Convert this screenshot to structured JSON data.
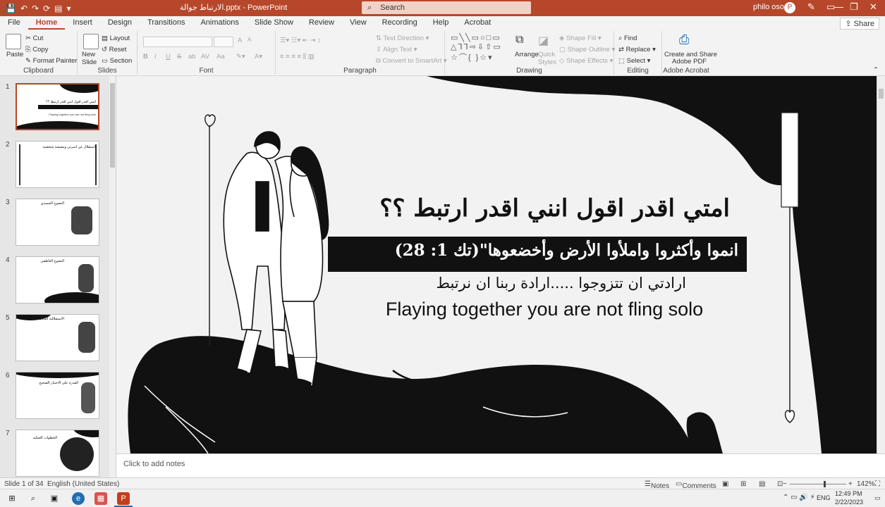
{
  "titlebar": {
    "qat": [
      "💾",
      "↶",
      "↷",
      "⟳",
      "▤",
      "▾"
    ],
    "doc_title": "الارتباط جوالة.pptx  -  PowerPoint",
    "search_placeholder": "Search",
    "user_name": "philo osos",
    "avatar_initial": "P",
    "controls": {
      "pen": "✎",
      "ribbon": "▭",
      "minimize": "—",
      "maximize": "❐",
      "close": "✕"
    }
  },
  "tabs": [
    "File",
    "Home",
    "Insert",
    "Design",
    "Transitions",
    "Animations",
    "Slide Show",
    "Review",
    "View",
    "Recording",
    "Help",
    "Acrobat"
  ],
  "active_tab": "Home",
  "share_label": "Share",
  "ribbon": {
    "clipboard": {
      "paste": "Paste",
      "cut": "Cut",
      "copy": "Copy",
      "format_painter": "Format Painter",
      "label": "Clipboard"
    },
    "slides": {
      "new_slide": "New Slide",
      "layout": "Layout",
      "reset": "Reset",
      "section": "Section",
      "label": "Slides"
    },
    "font": {
      "label": "Font",
      "bold": "B",
      "italic": "I",
      "underline": "U",
      "strike": "S",
      "shadow": "ab",
      "spacing": "AV",
      "case": "Aa",
      "grow": "A",
      "shrink": "A"
    },
    "paragraph": {
      "label": "Paragraph",
      "text_direction": "Text Direction",
      "align_text": "Align Text",
      "convert_smartart": "Convert to SmartArt"
    },
    "drawing": {
      "label": "Drawing",
      "arrange": "Arrange",
      "quick_styles": "Quick Styles",
      "shape_fill": "Shape Fill",
      "shape_outline": "Shape Outline",
      "shape_effects": "Shape Effects"
    },
    "editing": {
      "label": "Editing",
      "find": "Find",
      "replace": "Replace",
      "select": "Select"
    },
    "acrobat": {
      "label": "Adobe Acrobat",
      "create_share": "Create and Share",
      "adobe_pdf": "Adobe PDF"
    }
  },
  "thumbnails": [
    {
      "num": "1",
      "title": "امتي اقدر اقول انني اقدر ارتبط ؟؟",
      "sub": "Flaying together you are not fling solo"
    },
    {
      "num": "2",
      "title": "استقلال عن اسرتي ومعيشة شخصية",
      "sub": ""
    },
    {
      "num": "3",
      "title": "النضوج الجسدي",
      "sub": ""
    },
    {
      "num": "4",
      "title": "النضوج العاطفي",
      "sub": ""
    },
    {
      "num": "5",
      "title": "الاستقلالية المادية",
      "sub": ""
    },
    {
      "num": "6",
      "title": "القدرة على الاختيار الصحيح",
      "sub": ""
    },
    {
      "num": "7",
      "title": "الخطوات العملية",
      "sub": ""
    }
  ],
  "slide": {
    "title": "امتي اقدر اقول انني اقدر ارتبط ؟؟",
    "banner": "انموا وأكثروا واملأوا الأرض وأخضعوها\"(تك 1: 28)",
    "line_ar": "ارادتي ان تتزوجوا .....ارادة ربنا ان نرتبط",
    "line_en": "Flaying together you are not fling solo"
  },
  "notes_placeholder": "Click to add notes",
  "status": {
    "slide_of": "Slide 1 of 34",
    "language": "English (United States)",
    "notes": "Notes",
    "comments": "Comments",
    "zoom": "142%"
  },
  "taskbar": {
    "lang": "ENG",
    "time": "12:49 PM",
    "date": "2/22/2023"
  },
  "colors": {
    "accent": "#b7472a",
    "slide_bg": "#f2f2f2",
    "banner": "#111111"
  }
}
